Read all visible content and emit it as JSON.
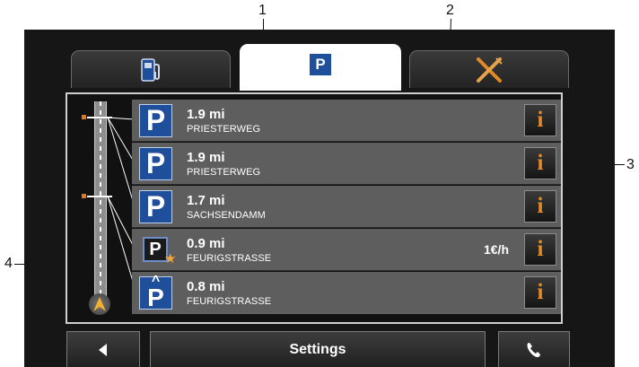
{
  "callouts": {
    "c1": "1",
    "c2": "2",
    "c3": "3",
    "c4": "4"
  },
  "tabs": [
    {
      "icon": "fuel-pump-icon",
      "active": false
    },
    {
      "icon": "parking-icon",
      "label": "P",
      "active": true
    },
    {
      "icon": "restaurant-fork-knife-icon",
      "active": false
    }
  ],
  "parking_list": [
    {
      "icon_letter": "P",
      "distance": "1.9 mi",
      "street": "PRIESTERWEG",
      "price": ""
    },
    {
      "icon_letter": "P",
      "distance": "1.9 mi",
      "street": "PRIESTERWEG",
      "price": ""
    },
    {
      "icon_letter": "P",
      "distance": "1.7 mi",
      "street": "SACHSENDAMM",
      "price": ""
    },
    {
      "icon_letter": "P",
      "distance": "0.9 mi",
      "street": "FEURIGSTRASSE",
      "price": "1€/h"
    },
    {
      "icon_letter": "P",
      "distance": "0.8 mi",
      "street": "FEURIGSTRASSE",
      "price": ""
    }
  ],
  "info_label": "i",
  "bottom_bar": {
    "settings_label": "Settings"
  },
  "colors": {
    "parking_blue": "#1f4e9a",
    "info_orange": "#e38b24",
    "row_gray": "#5e5e5e"
  }
}
